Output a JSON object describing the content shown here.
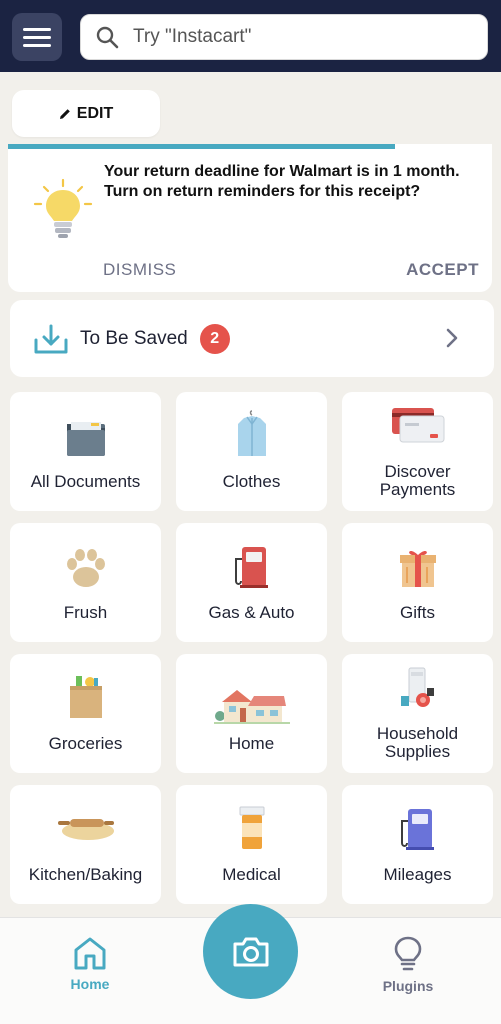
{
  "search": {
    "placeholder": "Try \"Instacart\""
  },
  "edit": {
    "label": "EDIT"
  },
  "reminder": {
    "message": "Your return deadline for Walmart is in 1 month. Turn on return reminders for this receipt?",
    "dismiss_label": "DISMISS",
    "accept_label": "ACCEPT",
    "progress": 0.8
  },
  "to_be_saved": {
    "label": "To Be Saved",
    "count": "2"
  },
  "categories": [
    {
      "name": "All Documents",
      "icon": "folder-icon"
    },
    {
      "name": "Clothes",
      "icon": "shirt-icon"
    },
    {
      "name": "Discover\nPayments",
      "icon": "credit-cards-icon"
    },
    {
      "name": "Frush",
      "icon": "paw-icon"
    },
    {
      "name": "Gas & Auto",
      "icon": "gas-pump-icon"
    },
    {
      "name": "Gifts",
      "icon": "gift-icon"
    },
    {
      "name": "Groceries",
      "icon": "grocery-bag-icon"
    },
    {
      "name": "Home",
      "icon": "house-icon"
    },
    {
      "name": "Household\nSupplies",
      "icon": "appliances-icon"
    },
    {
      "name": "Kitchen/Baking",
      "icon": "rolling-pin-icon"
    },
    {
      "name": "Medical",
      "icon": "pill-bottle-icon"
    },
    {
      "name": "Mileages",
      "icon": "fuel-pump-icon"
    }
  ],
  "tabbar": {
    "home_label": "Home",
    "plugins_label": "Plugins"
  },
  "colors": {
    "accent": "#48a9c1",
    "topbar": "#1b2342",
    "badge": "#e5534b"
  }
}
